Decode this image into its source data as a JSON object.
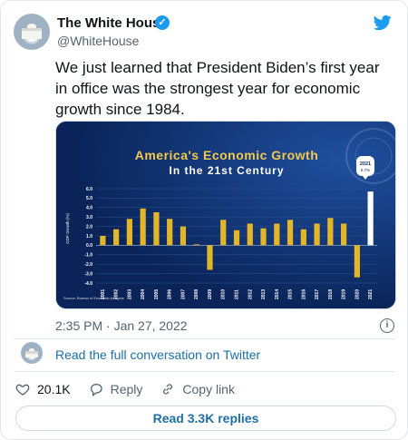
{
  "tweet": {
    "author_name": "The White House",
    "handle": "@WhiteHouse",
    "text": "We just learned that President Biden’s first year in office was the strongest year for economic growth since 1984.",
    "timestamp": "2:35 PM · Jan 27, 2022",
    "conversation_link": "Read the full conversation on Twitter",
    "likes": "20.1K",
    "reply_label": "Reply",
    "copy_link_label": "Copy link",
    "replies_button": "Read 3.3K replies"
  },
  "colors": {
    "twitter_blue": "#1d9bf0",
    "link_blue": "#1d6fa5",
    "chart_background": "#0c2a63",
    "bar_gold": "#e3b62a",
    "bar_highlight": "#ffffff"
  },
  "icons": [
    "verified-badge-icon",
    "twitter-bird-icon",
    "info-icon",
    "heart-icon",
    "reply-icon",
    "link-icon"
  ],
  "chart_data": {
    "type": "bar",
    "title": "America's Economic Growth",
    "subtitle": "In the 21st Century",
    "ylabel": "GDP Growth (%)",
    "source": "Source: Bureau of Economic Analysis",
    "highlight_label_year": "2021",
    "highlight_label_value": "5.7%",
    "ylim": [
      -4.0,
      6.0
    ],
    "yticks": [
      "6.0",
      "5.0",
      "4.0",
      "3.0",
      "2.0",
      "1.0",
      "0.0",
      "-1.0",
      "-2.0",
      "-3.0",
      "-4.0"
    ],
    "categories": [
      "2001",
      "2002",
      "2003",
      "2004",
      "2005",
      "2006",
      "2007",
      "2008",
      "2009",
      "2010",
      "2011",
      "2012",
      "2013",
      "2014",
      "2015",
      "2016",
      "2017",
      "2018",
      "2019",
      "2020",
      "2021"
    ],
    "values": [
      1.0,
      1.7,
      2.8,
      3.9,
      3.5,
      2.8,
      2.0,
      0.1,
      -2.6,
      2.7,
      1.6,
      2.3,
      1.8,
      2.3,
      2.7,
      1.7,
      2.3,
      2.9,
      2.3,
      -3.4,
      5.7
    ],
    "grid": true
  }
}
